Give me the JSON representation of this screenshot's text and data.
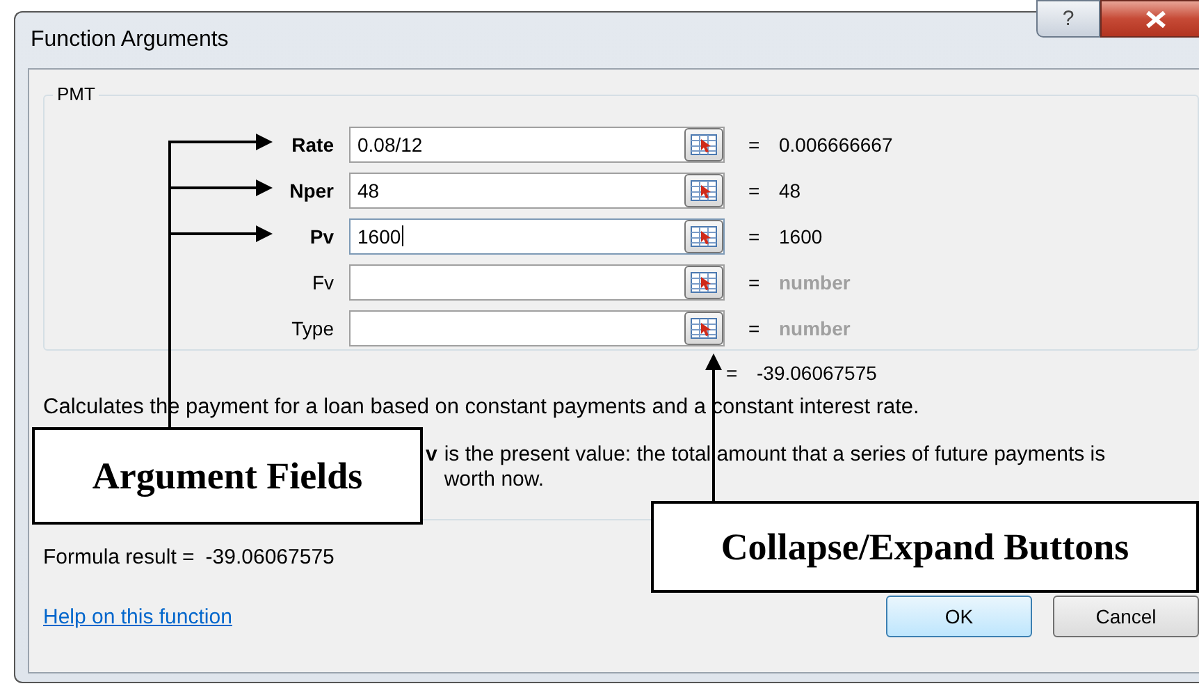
{
  "window": {
    "title": "Function Arguments",
    "help_button": "?"
  },
  "function_name": "PMT",
  "arguments": [
    {
      "label": "Rate",
      "required": true,
      "value": "0.08/12",
      "focused": false,
      "equals": "=",
      "result": "0.006666667",
      "result_muted": false
    },
    {
      "label": "Nper",
      "required": true,
      "value": "48",
      "focused": false,
      "equals": "=",
      "result": "48",
      "result_muted": false
    },
    {
      "label": "Pv",
      "required": true,
      "value": "1600",
      "focused": true,
      "equals": "=",
      "result": "1600",
      "result_muted": false
    },
    {
      "label": "Fv",
      "required": false,
      "focused": false,
      "equals": "=",
      "result": "number",
      "result_muted": true
    },
    {
      "label": "Type",
      "required": false,
      "focused": false,
      "equals": "=",
      "result": "number",
      "result_muted": true
    }
  ],
  "total_equals": "=",
  "total_result": "-39.06067575",
  "description": "Calculates the payment for a loan based on constant payments and a constant interest rate.",
  "argument_help": {
    "label": "v",
    "text": "is the present value: the total amount that a series of future payments is worth now."
  },
  "formula_result": {
    "label": "Formula result =",
    "value": "-39.06067575"
  },
  "help_link": "Help on this function",
  "buttons": [
    {
      "label": "OK",
      "default": true
    },
    {
      "label": "Cancel",
      "default": false
    }
  ],
  "callouts": [
    "Argument Fields",
    "Collapse/Expand Buttons"
  ]
}
